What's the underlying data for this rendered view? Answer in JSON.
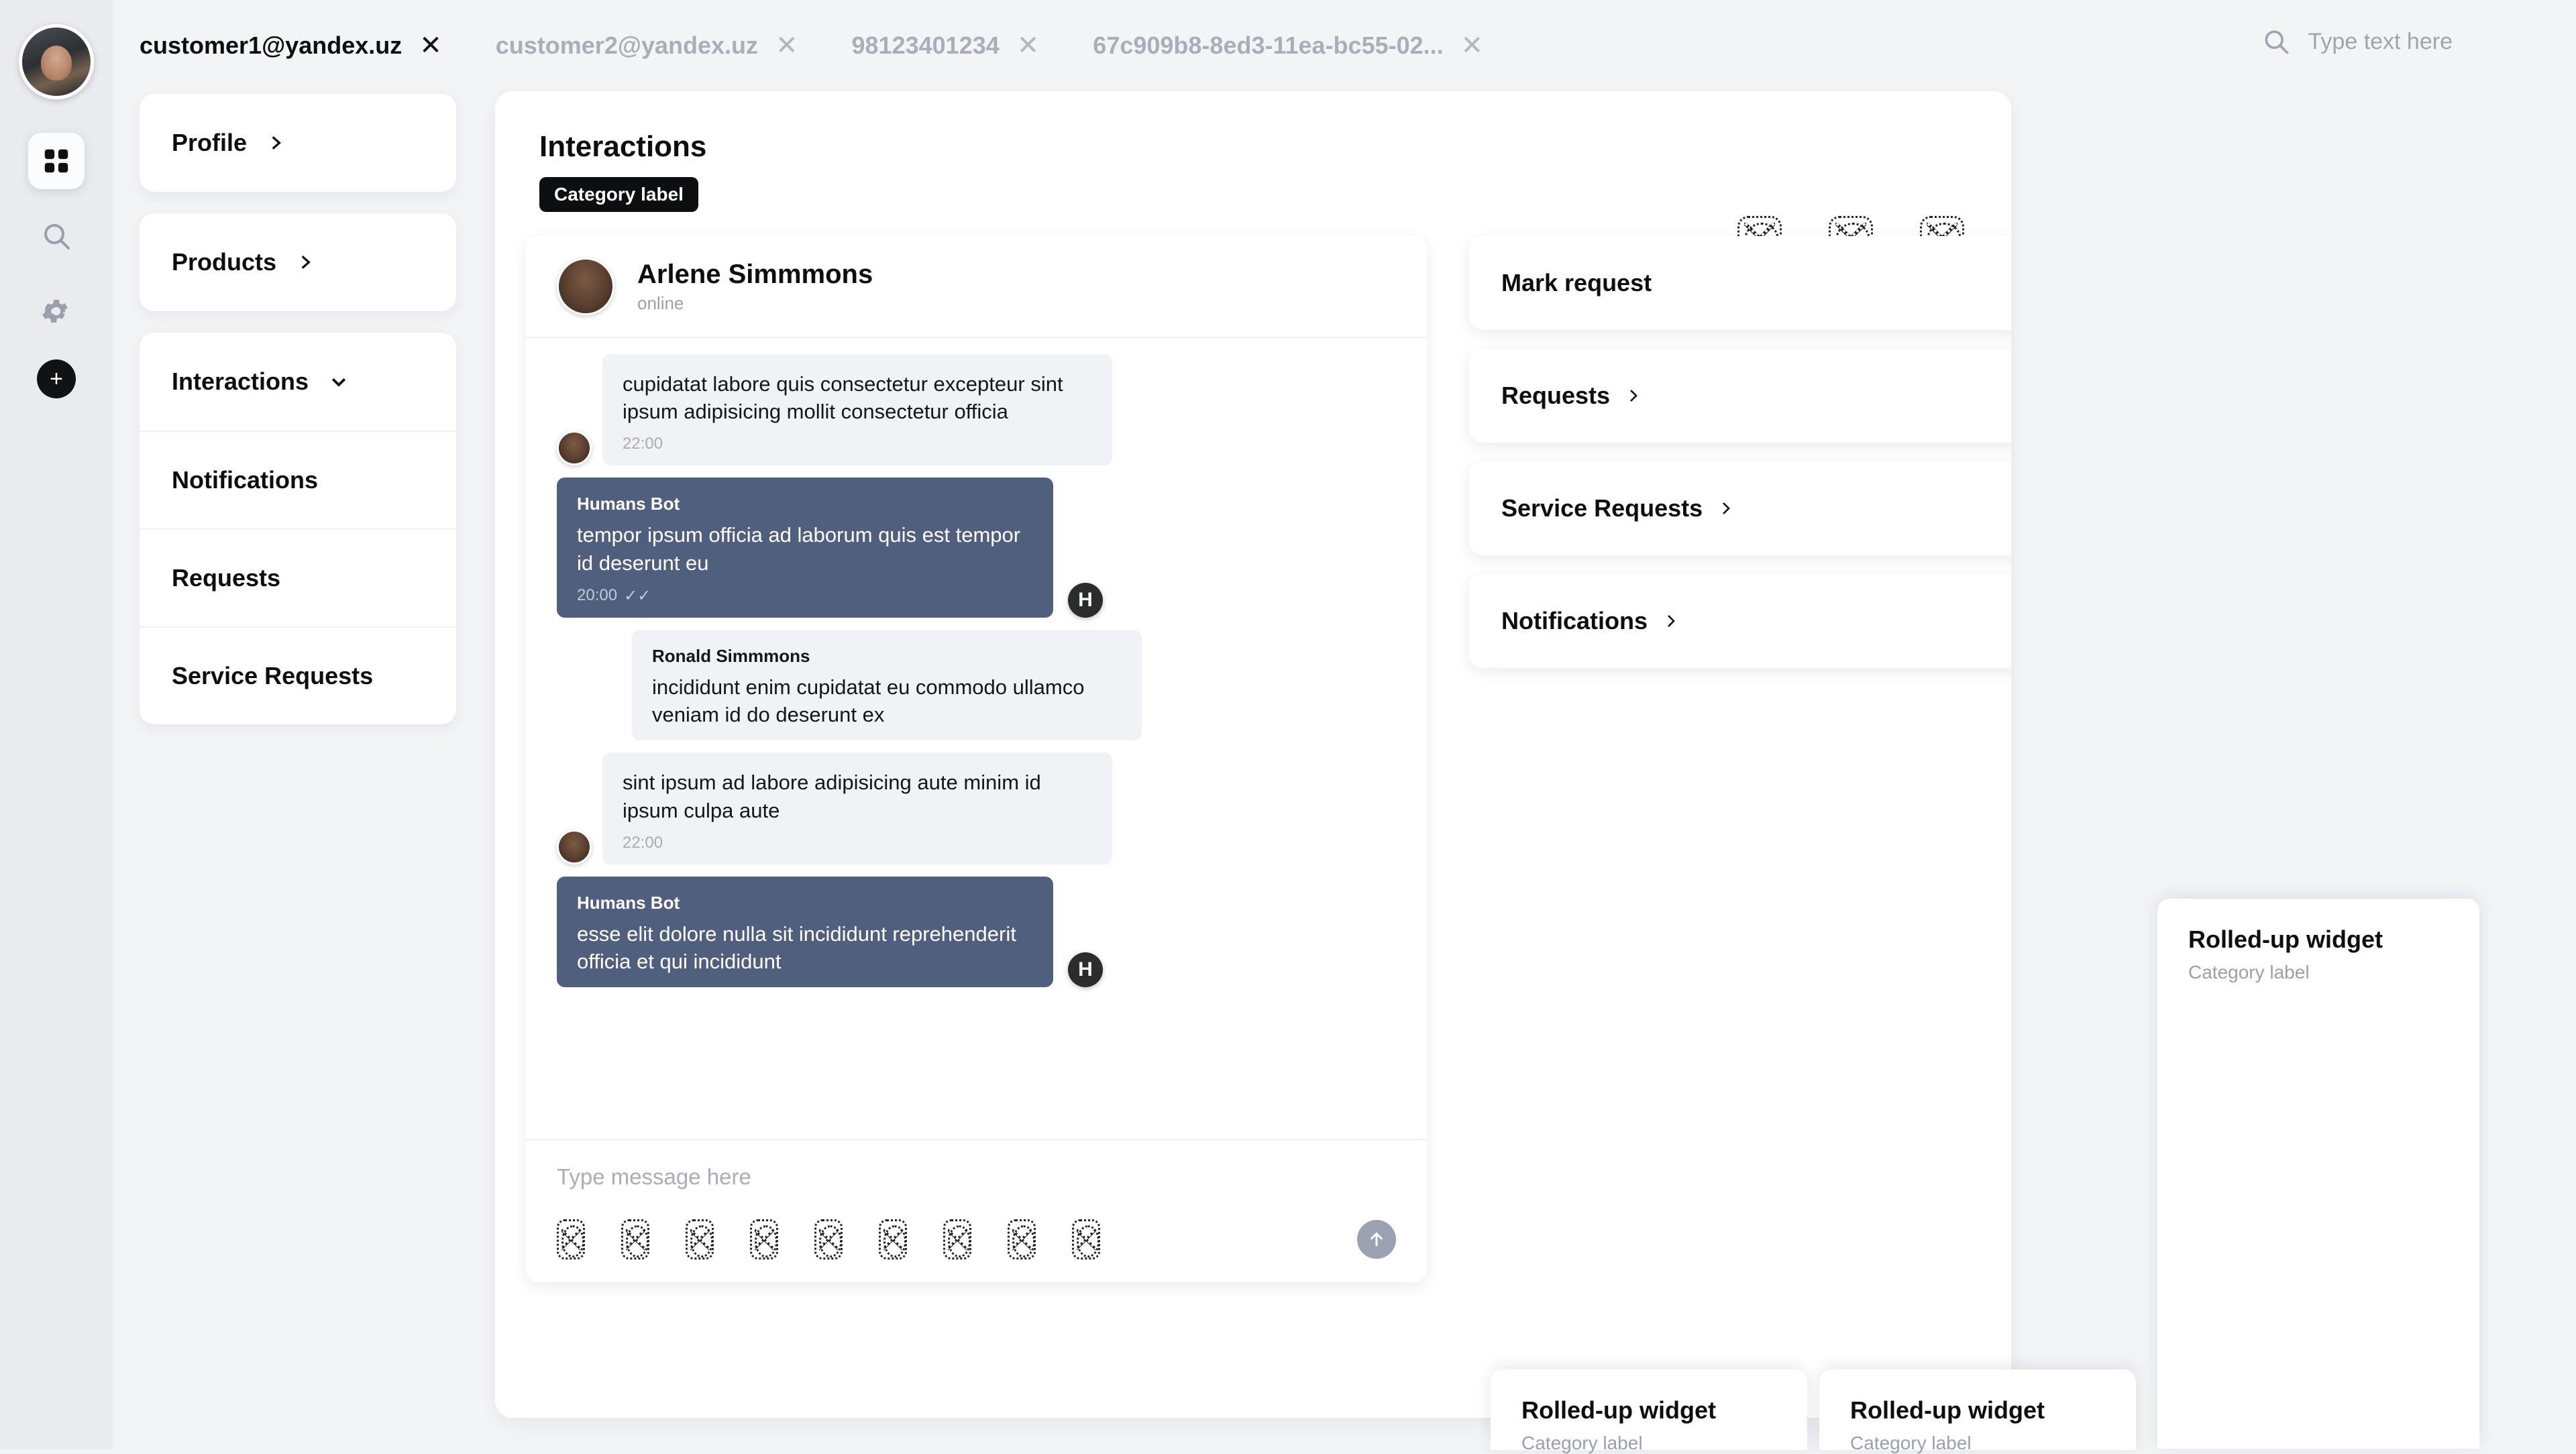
{
  "app": {
    "accent_dark": "#0d0e10",
    "bubble_out_color": "#505f7d",
    "bubble_in_color": "#f1f2f5",
    "rail_bg": "#eaebef",
    "page_bg": "#f3f4f6"
  },
  "rail": {
    "avatar": "user-avatar",
    "items": [
      {
        "name": "grid-icon",
        "label": "Dashboard",
        "active": true
      },
      {
        "name": "search-icon",
        "label": "Search",
        "active": false
      },
      {
        "name": "gear-icon",
        "label": "Settings",
        "active": false
      }
    ],
    "add_label": "+"
  },
  "tabs": [
    {
      "label": "customer1@yandex.uz",
      "active": true,
      "close": "✕"
    },
    {
      "label": "customer2@yandex.uz",
      "active": false,
      "close": "✕"
    },
    {
      "label": "98123401234",
      "active": false,
      "close": "✕"
    },
    {
      "label": "67c909b8-8ed3-11ea-bc55-02...",
      "active": false,
      "close": "✕"
    }
  ],
  "search": {
    "icon": "search-icon",
    "placeholder": "Type text here",
    "value": ""
  },
  "nav": {
    "groups": [
      {
        "items": [
          {
            "label": "Profile",
            "chevron": "right"
          }
        ]
      },
      {
        "items": [
          {
            "label": "Products",
            "chevron": "right"
          }
        ]
      },
      {
        "items": [
          {
            "label": "Interactions",
            "chevron": "down"
          },
          {
            "label": "Notifications",
            "chevron": "none"
          },
          {
            "label": "Requests",
            "chevron": "none"
          },
          {
            "label": "Service Requests",
            "chevron": "none"
          }
        ]
      }
    ]
  },
  "main": {
    "title": "Interactions",
    "category_label": "Category label",
    "header_icons": [
      "placeholder-icon",
      "placeholder-icon",
      "placeholder-icon"
    ]
  },
  "chat": {
    "contact_name": "Arlene Simmmons",
    "contact_status": "online",
    "messages": [
      {
        "direction": "in",
        "sender": "",
        "text": "cupidatat labore quis consectetur excepteur sint ipsum adipisicing mollit consectetur officia",
        "time": "22:00",
        "avatar": true,
        "read": false
      },
      {
        "direction": "out",
        "sender": "Humans Bot",
        "text": "tempor ipsum officia ad laborum quis est tempor id deserunt eu",
        "time": "20:00",
        "avatar": true,
        "read": true,
        "read_mark": "✓✓"
      },
      {
        "direction": "in",
        "sender": "Ronald Simmmons",
        "text": "incididunt enim cupidatat eu commodo ullamco veniam id do deserunt ex",
        "time": "",
        "avatar": false,
        "read": false
      },
      {
        "direction": "in",
        "sender": "",
        "text": "sint ipsum ad labore adipisicing aute minim id ipsum culpa aute",
        "time": "22:00",
        "avatar": true,
        "read": false
      },
      {
        "direction": "out",
        "sender": "Humans Bot",
        "text": "esse elit dolore nulla sit incididunt reprehenderit officia et qui incididunt",
        "time": "",
        "avatar": true,
        "read": false
      }
    ],
    "composer": {
      "placeholder": "Type message here",
      "value": "",
      "attachment_icons": [
        "placeholder-icon",
        "placeholder-icon",
        "placeholder-icon",
        "placeholder-icon",
        "placeholder-icon",
        "placeholder-icon",
        "placeholder-icon",
        "placeholder-icon",
        "placeholder-icon"
      ],
      "send_icon": "arrow-up-icon"
    },
    "bot_avatar_glyph": "H"
  },
  "right_cards": [
    {
      "label": "Mark request",
      "chevron": false,
      "icons": [
        "info-icon",
        "warning-icon",
        "gear-icon"
      ]
    },
    {
      "label": "Requests",
      "chevron": true,
      "icons": [
        "link-icon",
        "refresh-icon"
      ]
    },
    {
      "label": "Service Requests",
      "chevron": true,
      "icons": [
        "filter-icon",
        "refresh-icon"
      ]
    },
    {
      "label": "Notifications",
      "chevron": true,
      "icons": [
        "send-icon",
        "refresh-icon"
      ]
    }
  ],
  "widgets": [
    {
      "title": "Rolled-up widget",
      "category": "Category label"
    },
    {
      "title": "Rolled-up widget",
      "category": "Category label"
    },
    {
      "title": "Rolled-up widget",
      "category": "Category label"
    }
  ]
}
